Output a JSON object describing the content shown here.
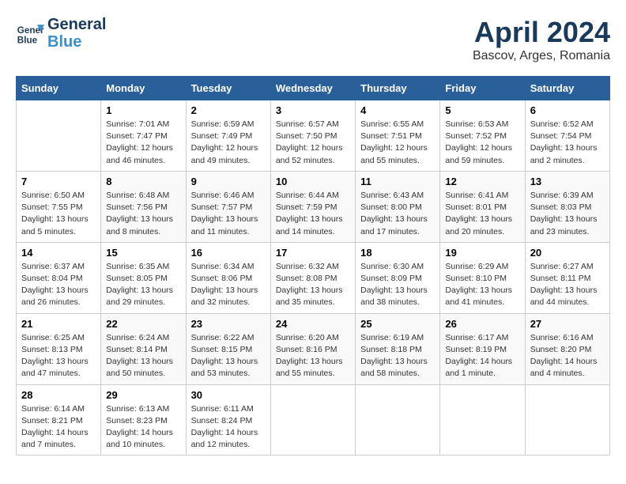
{
  "logo": {
    "line1": "General",
    "line2": "Blue"
  },
  "title": "April 2024",
  "subtitle": "Bascov, Arges, Romania",
  "days_of_week": [
    "Sunday",
    "Monday",
    "Tuesday",
    "Wednesday",
    "Thursday",
    "Friday",
    "Saturday"
  ],
  "weeks": [
    [
      {
        "num": "",
        "info": ""
      },
      {
        "num": "1",
        "info": "Sunrise: 7:01 AM\nSunset: 7:47 PM\nDaylight: 12 hours\nand 46 minutes."
      },
      {
        "num": "2",
        "info": "Sunrise: 6:59 AM\nSunset: 7:49 PM\nDaylight: 12 hours\nand 49 minutes."
      },
      {
        "num": "3",
        "info": "Sunrise: 6:57 AM\nSunset: 7:50 PM\nDaylight: 12 hours\nand 52 minutes."
      },
      {
        "num": "4",
        "info": "Sunrise: 6:55 AM\nSunset: 7:51 PM\nDaylight: 12 hours\nand 55 minutes."
      },
      {
        "num": "5",
        "info": "Sunrise: 6:53 AM\nSunset: 7:52 PM\nDaylight: 12 hours\nand 59 minutes."
      },
      {
        "num": "6",
        "info": "Sunrise: 6:52 AM\nSunset: 7:54 PM\nDaylight: 13 hours\nand 2 minutes."
      }
    ],
    [
      {
        "num": "7",
        "info": "Sunrise: 6:50 AM\nSunset: 7:55 PM\nDaylight: 13 hours\nand 5 minutes."
      },
      {
        "num": "8",
        "info": "Sunrise: 6:48 AM\nSunset: 7:56 PM\nDaylight: 13 hours\nand 8 minutes."
      },
      {
        "num": "9",
        "info": "Sunrise: 6:46 AM\nSunset: 7:57 PM\nDaylight: 13 hours\nand 11 minutes."
      },
      {
        "num": "10",
        "info": "Sunrise: 6:44 AM\nSunset: 7:59 PM\nDaylight: 13 hours\nand 14 minutes."
      },
      {
        "num": "11",
        "info": "Sunrise: 6:43 AM\nSunset: 8:00 PM\nDaylight: 13 hours\nand 17 minutes."
      },
      {
        "num": "12",
        "info": "Sunrise: 6:41 AM\nSunset: 8:01 PM\nDaylight: 13 hours\nand 20 minutes."
      },
      {
        "num": "13",
        "info": "Sunrise: 6:39 AM\nSunset: 8:03 PM\nDaylight: 13 hours\nand 23 minutes."
      }
    ],
    [
      {
        "num": "14",
        "info": "Sunrise: 6:37 AM\nSunset: 8:04 PM\nDaylight: 13 hours\nand 26 minutes."
      },
      {
        "num": "15",
        "info": "Sunrise: 6:35 AM\nSunset: 8:05 PM\nDaylight: 13 hours\nand 29 minutes."
      },
      {
        "num": "16",
        "info": "Sunrise: 6:34 AM\nSunset: 8:06 PM\nDaylight: 13 hours\nand 32 minutes."
      },
      {
        "num": "17",
        "info": "Sunrise: 6:32 AM\nSunset: 8:08 PM\nDaylight: 13 hours\nand 35 minutes."
      },
      {
        "num": "18",
        "info": "Sunrise: 6:30 AM\nSunset: 8:09 PM\nDaylight: 13 hours\nand 38 minutes."
      },
      {
        "num": "19",
        "info": "Sunrise: 6:29 AM\nSunset: 8:10 PM\nDaylight: 13 hours\nand 41 minutes."
      },
      {
        "num": "20",
        "info": "Sunrise: 6:27 AM\nSunset: 8:11 PM\nDaylight: 13 hours\nand 44 minutes."
      }
    ],
    [
      {
        "num": "21",
        "info": "Sunrise: 6:25 AM\nSunset: 8:13 PM\nDaylight: 13 hours\nand 47 minutes."
      },
      {
        "num": "22",
        "info": "Sunrise: 6:24 AM\nSunset: 8:14 PM\nDaylight: 13 hours\nand 50 minutes."
      },
      {
        "num": "23",
        "info": "Sunrise: 6:22 AM\nSunset: 8:15 PM\nDaylight: 13 hours\nand 53 minutes."
      },
      {
        "num": "24",
        "info": "Sunrise: 6:20 AM\nSunset: 8:16 PM\nDaylight: 13 hours\nand 55 minutes."
      },
      {
        "num": "25",
        "info": "Sunrise: 6:19 AM\nSunset: 8:18 PM\nDaylight: 13 hours\nand 58 minutes."
      },
      {
        "num": "26",
        "info": "Sunrise: 6:17 AM\nSunset: 8:19 PM\nDaylight: 14 hours\nand 1 minute."
      },
      {
        "num": "27",
        "info": "Sunrise: 6:16 AM\nSunset: 8:20 PM\nDaylight: 14 hours\nand 4 minutes."
      }
    ],
    [
      {
        "num": "28",
        "info": "Sunrise: 6:14 AM\nSunset: 8:21 PM\nDaylight: 14 hours\nand 7 minutes."
      },
      {
        "num": "29",
        "info": "Sunrise: 6:13 AM\nSunset: 8:23 PM\nDaylight: 14 hours\nand 10 minutes."
      },
      {
        "num": "30",
        "info": "Sunrise: 6:11 AM\nSunset: 8:24 PM\nDaylight: 14 hours\nand 12 minutes."
      },
      {
        "num": "",
        "info": ""
      },
      {
        "num": "",
        "info": ""
      },
      {
        "num": "",
        "info": ""
      },
      {
        "num": "",
        "info": ""
      }
    ]
  ]
}
